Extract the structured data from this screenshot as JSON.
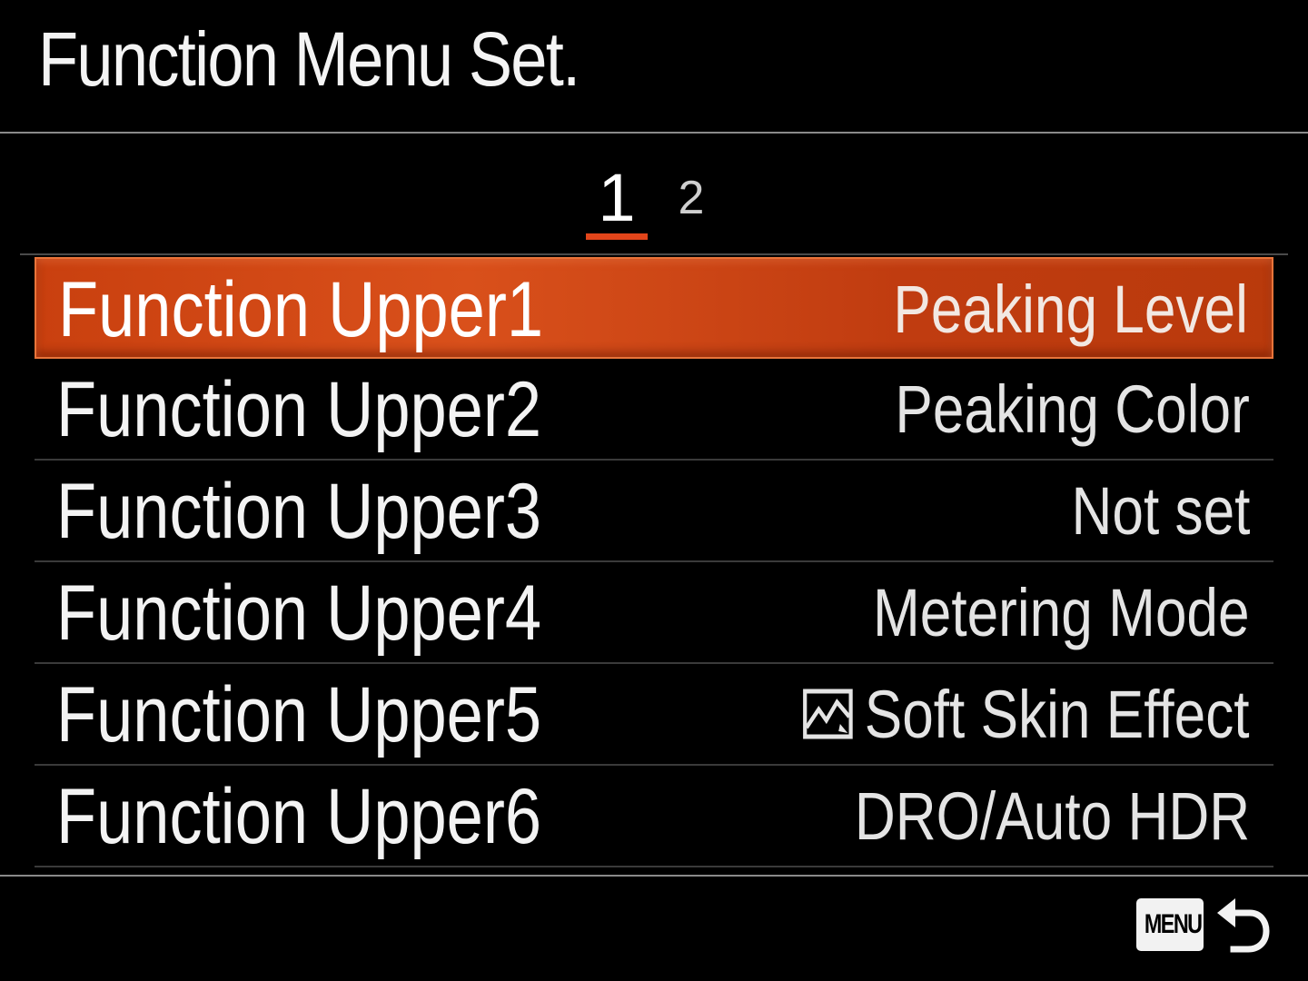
{
  "header": {
    "title": "Function Menu Set."
  },
  "pager": {
    "pages": [
      {
        "label": "1",
        "active": true
      },
      {
        "label": "2",
        "active": false
      }
    ]
  },
  "menu": {
    "items": [
      {
        "label": "Function Upper1",
        "value": "Peaking Level",
        "selected": true
      },
      {
        "label": "Function Upper2",
        "value": "Peaking Color",
        "selected": false
      },
      {
        "label": "Function Upper3",
        "value": "Not set",
        "selected": false
      },
      {
        "label": "Function Upper4",
        "value": "Metering Mode",
        "selected": false
      },
      {
        "label": "Function Upper5",
        "value": "Soft Skin Effect",
        "icon": "soft-skin-icon",
        "selected": false
      },
      {
        "label": "Function Upper6",
        "value": "DRO/Auto HDR",
        "selected": false
      }
    ]
  },
  "footer": {
    "menu_button_label": "MENU",
    "back_icon": "return-arrow-icon"
  },
  "colors": {
    "accent": "#e2451a",
    "selected_row": "#c9400f",
    "background": "#000000"
  }
}
